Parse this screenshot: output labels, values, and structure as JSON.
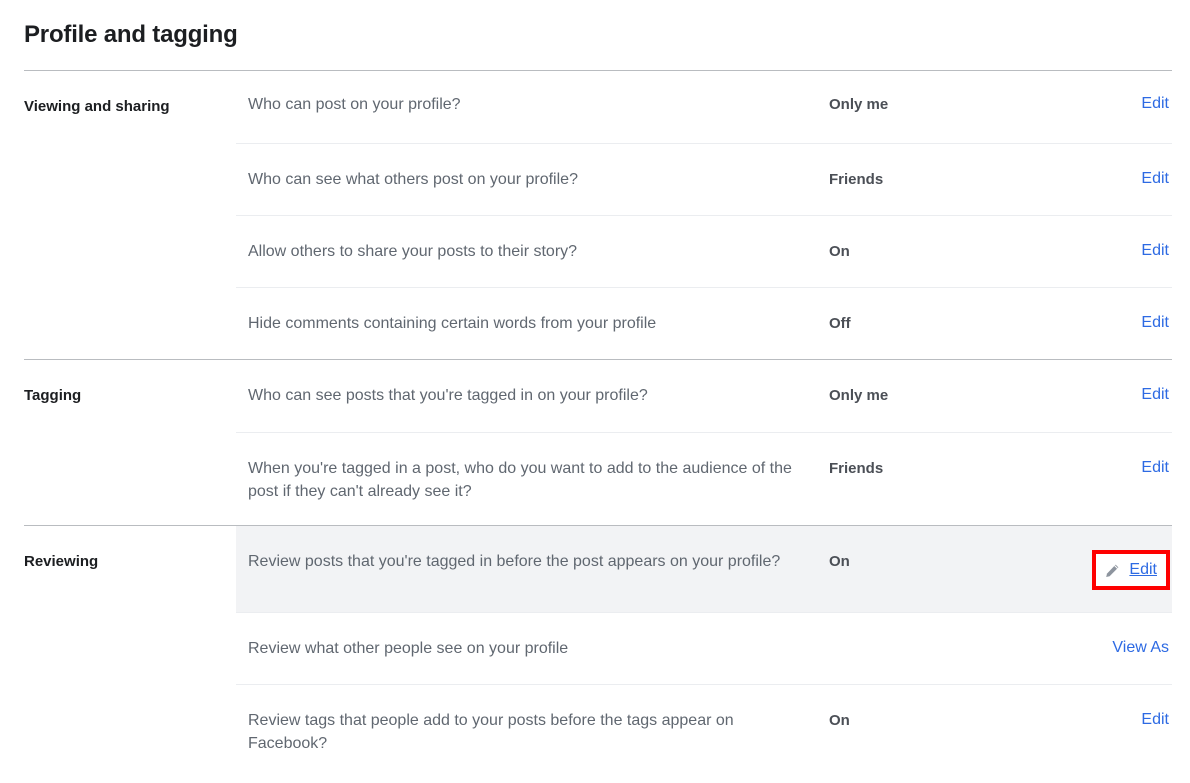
{
  "page": {
    "title": "Profile and tagging"
  },
  "sections": [
    {
      "label": "Viewing and sharing",
      "rows": [
        {
          "question": "Who can post on your profile?",
          "value": "Only me",
          "action": "Edit",
          "action_icon": "",
          "highlighted": false
        },
        {
          "question": "Who can see what others post on your profile?",
          "value": "Friends",
          "action": "Edit",
          "action_icon": "",
          "highlighted": false
        },
        {
          "question": "Allow others to share your posts to their story?",
          "value": "On",
          "action": "Edit",
          "action_icon": "",
          "highlighted": false
        },
        {
          "question": "Hide comments containing certain words from your profile",
          "value": "Off",
          "action": "Edit",
          "action_icon": "",
          "highlighted": false
        }
      ]
    },
    {
      "label": "Tagging",
      "rows": [
        {
          "question": "Who can see posts that you're tagged in on your profile?",
          "value": "Only me",
          "action": "Edit",
          "action_icon": "",
          "highlighted": false
        },
        {
          "question": "When you're tagged in a post, who do you want to add to the audience of the post if they can't already see it?",
          "value": "Friends",
          "action": "Edit",
          "action_icon": "",
          "highlighted": false
        }
      ]
    },
    {
      "label": "Reviewing",
      "rows": [
        {
          "question": "Review posts that you're tagged in before the post appears on your profile?",
          "value": "On",
          "action": "Edit",
          "action_icon": "pencil-icon",
          "highlighted": true
        },
        {
          "question": "Review what other people see on your profile",
          "value": "",
          "action": "View As",
          "action_icon": "",
          "highlighted": false
        },
        {
          "question": "Review tags that people add to your posts before the tags appear on Facebook?",
          "value": "On",
          "action": "Edit",
          "action_icon": "",
          "highlighted": false
        }
      ]
    }
  ],
  "colors": {
    "link": "#2d6ae3",
    "annotation_box": "#fe0000",
    "row_highlight": "#f2f3f5",
    "question_text": "#606770",
    "value_text": "#4b4f56"
  }
}
